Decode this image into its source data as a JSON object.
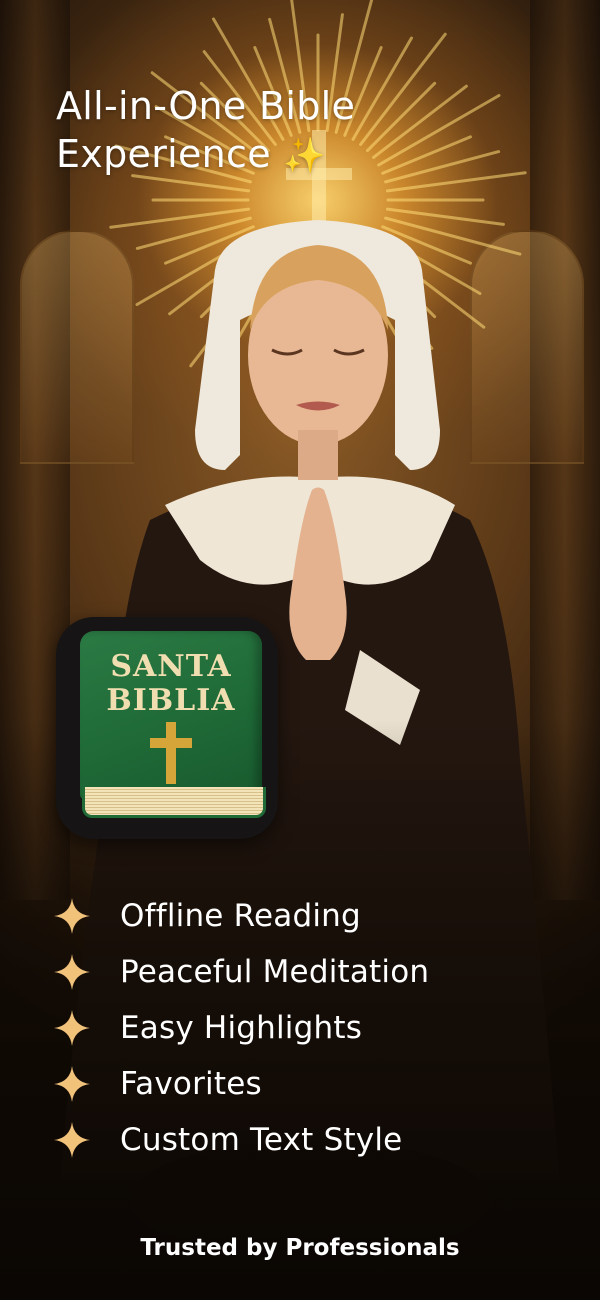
{
  "headline": {
    "line1": "All-in-One Bible",
    "line2": "Experience",
    "sparkle": "✨"
  },
  "app_icon": {
    "title_line1": "SANTA",
    "title_line2": "BIBLIA",
    "cover_color": "#1f6a37",
    "title_color": "#f1deb0",
    "cross_color": "#d6a53a"
  },
  "features": [
    {
      "icon": "four-point-star-icon",
      "label": "Offline Reading"
    },
    {
      "icon": "four-point-star-icon",
      "label": "Peaceful Meditation"
    },
    {
      "icon": "four-point-star-icon",
      "label": "Easy Highlights"
    },
    {
      "icon": "four-point-star-icon",
      "label": "Favorites"
    },
    {
      "icon": "four-point-star-icon",
      "label": "Custom Text Style"
    }
  ],
  "footer": {
    "text": "Trusted by Professionals"
  },
  "colors": {
    "accent_star": "#f0c27a",
    "glow": "#ffd66e"
  }
}
